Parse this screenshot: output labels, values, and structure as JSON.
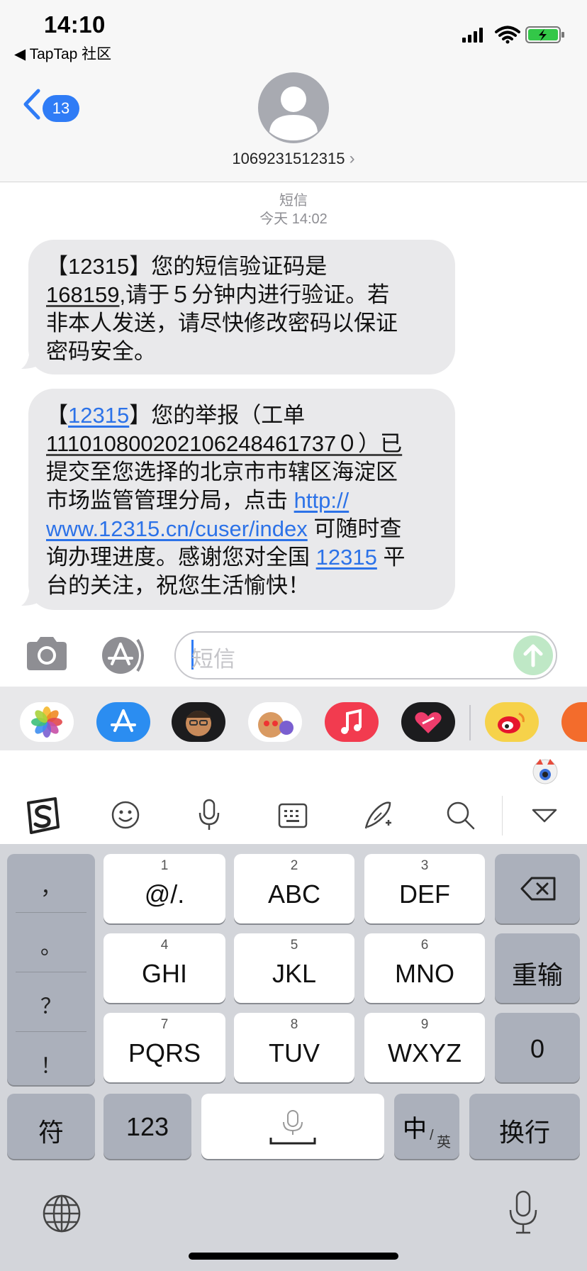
{
  "status_bar": {
    "time": "14:10",
    "back_app": "◀ TapTap 社区"
  },
  "header": {
    "unread_count": "13",
    "contact_number": "1069231512315",
    "contact_chevron": "›"
  },
  "thread": {
    "service_label": "短信",
    "timestamp": "今天 14:02"
  },
  "messages": [
    {
      "lines": [
        [
          "【12315】您的短信验证码是"
        ],
        [
          "168159",
          ",请于５分钟内进行验证。若"
        ],
        [
          "非本人发送，请尽快修改密码以保证"
        ],
        [
          "密码安全。"
        ]
      ]
    },
    {
      "lines": [
        [
          "【",
          "12315",
          "】您的举报（工单"
        ],
        [
          "111010800202106248461737０）已"
        ],
        [
          "提交至您选择的北京市市辖区海淀区"
        ],
        [
          "市场监管管理分局，点击 ",
          "http://"
        ],
        [
          "www.12315.cn/cuser/index",
          " 可随时查"
        ],
        [
          "询办理进度。感谢您对全国 ",
          "12315",
          " 平"
        ],
        [
          "台的关注，祝您生活愉快！"
        ]
      ]
    }
  ],
  "composer": {
    "placeholder": "短信"
  },
  "app_strip": {
    "apps": [
      "photos-icon",
      "app-store-icon",
      "memoji-icon",
      "animoji-icon",
      "music-icon",
      "digital-touch-icon",
      "weibo-icon",
      "extra-app-icon"
    ]
  },
  "keyboard": {
    "punctuation": [
      "，",
      "。",
      "？",
      "！"
    ],
    "keys": [
      {
        "num": "1",
        "label": "@/."
      },
      {
        "num": "2",
        "label": "ABC"
      },
      {
        "num": "3",
        "label": "DEF"
      },
      {
        "num": "4",
        "label": "GHI"
      },
      {
        "num": "5",
        "label": "JKL"
      },
      {
        "num": "6",
        "label": "MNO"
      },
      {
        "num": "7",
        "label": "PQRS"
      },
      {
        "num": "8",
        "label": "TUV"
      },
      {
        "num": "9",
        "label": "WXYZ"
      }
    ],
    "reenter": "重输",
    "zero": "0",
    "symbols": "符",
    "numbers": "123",
    "zh": "中",
    "en": "英",
    "return": "换行"
  },
  "colors": {
    "accent": "#2f7cf6",
    "bubble": "#e9e9eb",
    "link": "#2c72e8",
    "keyboard_bg": "#d3d5da"
  }
}
